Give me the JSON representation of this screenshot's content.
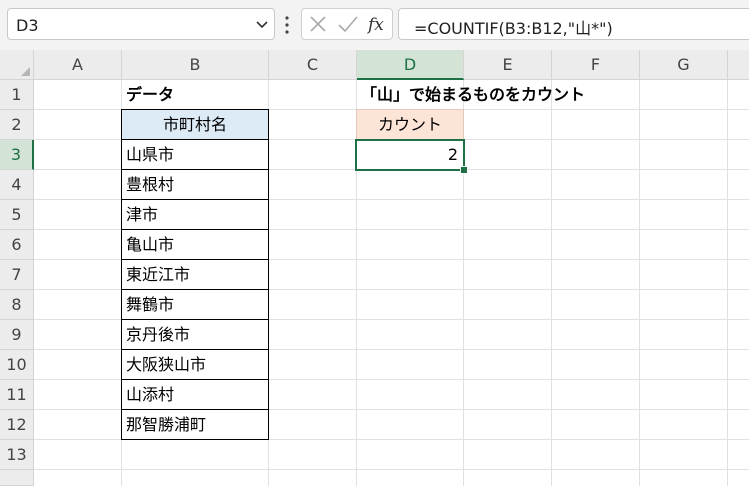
{
  "formula_bar": {
    "name_box": "D3",
    "cancel_icon": "x-icon",
    "enter_icon": "check-icon",
    "fx_label": "fx",
    "formula": "=COUNTIF(B3:B12,\"山*\")"
  },
  "sheet": {
    "columns": [
      "A",
      "B",
      "C",
      "D",
      "E",
      "F",
      "G"
    ],
    "rows": [
      "1",
      "2",
      "3",
      "4",
      "5",
      "6",
      "7",
      "8",
      "9",
      "10",
      "11",
      "12",
      "13"
    ],
    "active_cell": "D3",
    "cells": {
      "B1": "データ",
      "B2": "市町村名",
      "B3": "山県市",
      "B4": "豊根村",
      "B5": "津市",
      "B6": "亀山市",
      "B7": "東近江市",
      "B8": "舞鶴市",
      "B9": "京丹後市",
      "B10": "大阪狭山市",
      "B11": "山添村",
      "B12": "那智勝浦町",
      "D1": "「山」で始まるものをカウント",
      "D2": "カウント",
      "D3": "2"
    }
  },
  "colors": {
    "accent": "#1e7145",
    "header_fill_b": "#ddebf7",
    "header_fill_d": "#fce4d6"
  }
}
